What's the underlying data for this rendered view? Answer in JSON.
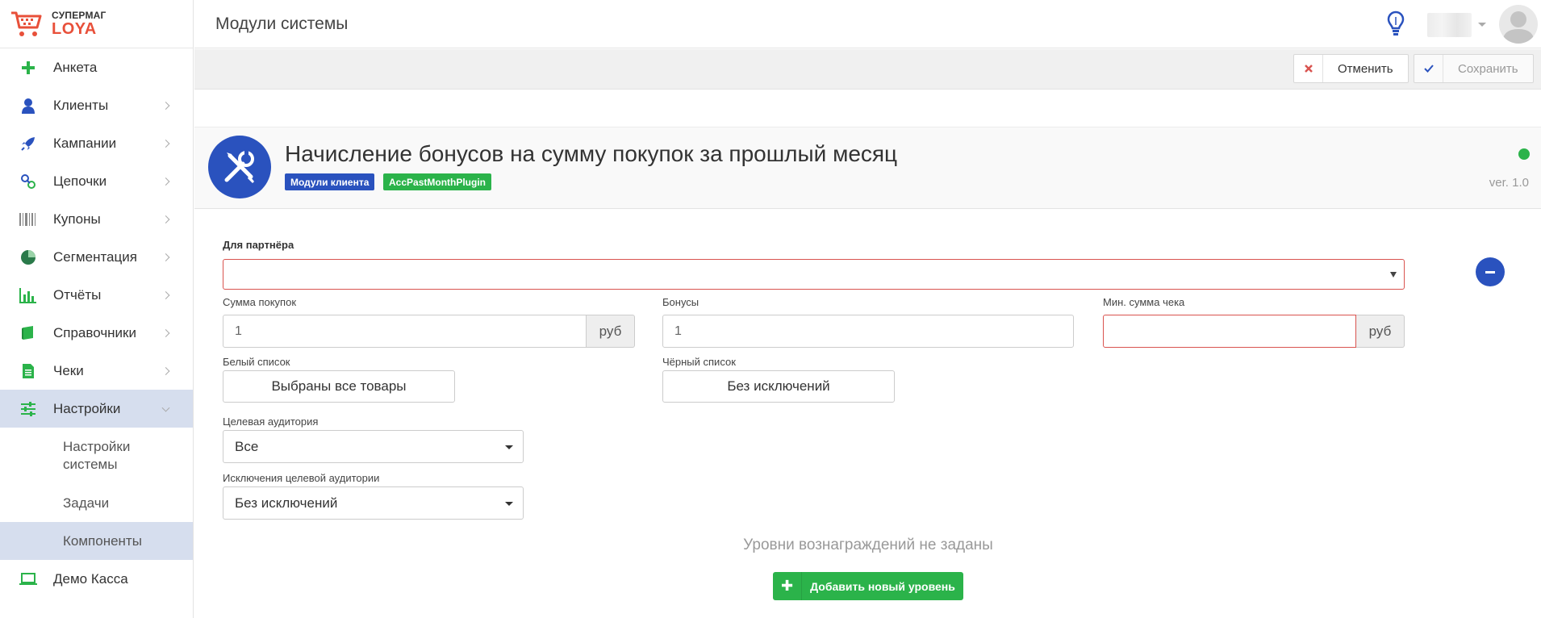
{
  "brand": {
    "top": "СУПЕРМАГ",
    "bottom": "LOYA"
  },
  "header": {
    "title": "Модули системы"
  },
  "sidebar": {
    "items": [
      {
        "label": "Анкета",
        "icon": "plus-icon"
      },
      {
        "label": "Клиенты",
        "icon": "user-icon"
      },
      {
        "label": "Кампании",
        "icon": "rocket-icon"
      },
      {
        "label": "Цепочки",
        "icon": "link-icon"
      },
      {
        "label": "Купоны",
        "icon": "barcode-icon"
      },
      {
        "label": "Сегментация",
        "icon": "pie-chart-icon"
      },
      {
        "label": "Отчёты",
        "icon": "bar-chart-icon"
      },
      {
        "label": "Справочники",
        "icon": "book-icon"
      },
      {
        "label": "Чеки",
        "icon": "receipt-icon"
      },
      {
        "label": "Настройки",
        "icon": "sliders-icon"
      }
    ],
    "subitems": [
      {
        "label": "Настройки системы"
      },
      {
        "label": "Задачи"
      },
      {
        "label": "Компоненты"
      }
    ],
    "last": {
      "label": "Демо Касса",
      "icon": "laptop-icon"
    }
  },
  "actions": {
    "cancel": "Отменить",
    "save": "Сохранить"
  },
  "plugin": {
    "title": "Начисление бонусов на сумму покупок за прошлый месяц",
    "tag_module": "Модули клиента",
    "tag_plugin": "AccPastMonthPlugin",
    "version": "ver. 1.0",
    "status_color": "#2bb34a"
  },
  "form": {
    "partner_label": "Для партнёра",
    "purchase_sum_label": "Сумма покупок",
    "purchase_sum_value": "1",
    "currency": "руб",
    "bonuses_label": "Бонусы",
    "bonuses_value": "1",
    "min_check_label": "Мин. сумма чека",
    "min_check_value": "",
    "whitelist_label": "Белый список",
    "whitelist_button": "Выбраны все товары",
    "blacklist_label": "Чёрный список",
    "blacklist_button": "Без исключений",
    "audience_label": "Целевая аудитория",
    "audience_value": "Все",
    "audience_exclusions_label": "Исключения целевой аудитории",
    "audience_exclusions_value": "Без исключений",
    "levels_empty": "Уровни вознаграждений не заданы",
    "add_level": "Добавить новый уровень"
  },
  "colors": {
    "accent_blue": "#2a52be",
    "success_green": "#2bb34a",
    "error_red": "#d9534f",
    "active_nav": "#d6deee"
  }
}
